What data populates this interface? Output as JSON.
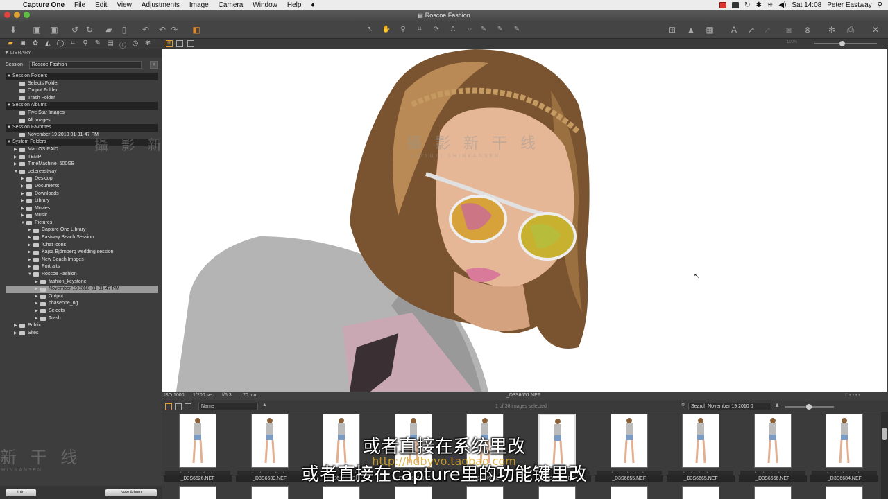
{
  "menubar": {
    "apple": "",
    "app": "Capture One",
    "items": [
      "File",
      "Edit",
      "View",
      "Adjustments",
      "Image",
      "Camera",
      "Window",
      "Help"
    ],
    "clock": "Sat 14:08",
    "user": "Peter Eastway"
  },
  "window": {
    "title": "Roscoe Fashion"
  },
  "sidebar": {
    "header": "LIBRARY",
    "session_label": "Session",
    "session_value": "Roscoe Fashion",
    "rows": [
      {
        "label": "Session Folders",
        "type": "sec",
        "indent": 0
      },
      {
        "label": "Selects Folder",
        "type": "item",
        "indent": 1
      },
      {
        "label": "Output Folder",
        "type": "item",
        "indent": 1
      },
      {
        "label": "Trash Folder",
        "type": "item",
        "indent": 1
      },
      {
        "label": "Session Albums",
        "type": "sec",
        "indent": 0
      },
      {
        "label": "Five Star Images",
        "type": "item",
        "indent": 1
      },
      {
        "label": "All Images",
        "type": "item",
        "indent": 1
      },
      {
        "label": "Session Favorites",
        "type": "sec",
        "indent": 0
      },
      {
        "label": "November 19 2010 01-31-47 PM",
        "type": "item",
        "indent": 1
      },
      {
        "label": "System Folders",
        "type": "sec",
        "indent": 0
      },
      {
        "label": "Mac OS RAID",
        "type": "folder",
        "indent": 1
      },
      {
        "label": "TEMP",
        "type": "folder",
        "indent": 1
      },
      {
        "label": "TimeMachine_500GB",
        "type": "folder",
        "indent": 1
      },
      {
        "label": "petereastway",
        "type": "folder",
        "indent": 1,
        "open": true
      },
      {
        "label": "Desktop",
        "type": "folder",
        "indent": 2
      },
      {
        "label": "Documents",
        "type": "folder",
        "indent": 2
      },
      {
        "label": "Downloads",
        "type": "folder",
        "indent": 2
      },
      {
        "label": "Library",
        "type": "folder",
        "indent": 2
      },
      {
        "label": "Movies",
        "type": "folder",
        "indent": 2
      },
      {
        "label": "Music",
        "type": "folder",
        "indent": 2
      },
      {
        "label": "Pictures",
        "type": "folder",
        "indent": 2,
        "open": true
      },
      {
        "label": "Capture One Library",
        "type": "folder",
        "indent": 3
      },
      {
        "label": "Eastway Beach Session",
        "type": "folder",
        "indent": 3
      },
      {
        "label": "iChat Icons",
        "type": "folder",
        "indent": 3
      },
      {
        "label": "Kajsa Björnberg wedding session",
        "type": "folder",
        "indent": 3
      },
      {
        "label": "New Beach Images",
        "type": "folder",
        "indent": 3
      },
      {
        "label": "Portraits",
        "type": "folder",
        "indent": 3
      },
      {
        "label": "Roscoe Fashion",
        "type": "folder",
        "indent": 3,
        "open": true
      },
      {
        "label": "fashion_keystone",
        "type": "folder",
        "indent": 4
      },
      {
        "label": "November 19 2010 01-31-47 PM",
        "type": "folder",
        "indent": 4,
        "selected": true
      },
      {
        "label": "Output",
        "type": "folder",
        "indent": 4
      },
      {
        "label": "phaseone_ug",
        "type": "folder",
        "indent": 4
      },
      {
        "label": "Selects",
        "type": "folder",
        "indent": 4
      },
      {
        "label": "Trash",
        "type": "folder",
        "indent": 4
      },
      {
        "label": "Public",
        "type": "folder",
        "indent": 1
      },
      {
        "label": "Sites",
        "type": "folder",
        "indent": 1
      }
    ],
    "info_button": "Info",
    "album_button": "New Album"
  },
  "viewer": {
    "zoom": "100%",
    "iso": "ISO 1000",
    "shutter": "1/200 sec",
    "aperture": "f/6.3",
    "focal": "70 mm",
    "filename": "_D3S6651.NEF"
  },
  "browser": {
    "sort_label": "Name",
    "count": "1 of 36 images selected",
    "search_placeholder": "Search November 19 2010 0",
    "stars": "• • • • •",
    "thumbnails": [
      {
        "name": "_D3S6626.NEF"
      },
      {
        "name": "_D3S6639.NEF"
      },
      {
        "name": "_D3S6643.NEF"
      },
      {
        "name": "_D3S6646.NEF"
      },
      {
        "name": "_D3S6649.NEF"
      },
      {
        "name": "_D3S6651.NEF",
        "selected": true
      },
      {
        "name": "_D3S6655.NEF"
      },
      {
        "name": "_D3S6665.NEF"
      },
      {
        "name": "_D3S6666.NEF"
      },
      {
        "name": "_D3S6684.NEF"
      }
    ]
  },
  "overlay": {
    "subtitle1": "或者直接在系统里改",
    "subtitle2": "或者直接在capture里的功能键里改",
    "url": "http://hdbyvo.taobao.com",
    "watermark_cn": "攝 影 新 干 线",
    "watermark_en": "SATSUEI SHINKANSEN",
    "watermark_left": "新 干 线",
    "watermark_left_en": "HINKANSEN"
  }
}
